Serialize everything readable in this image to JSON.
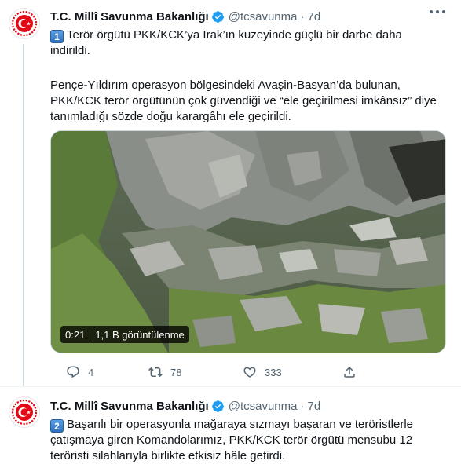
{
  "tweets": [
    {
      "account_name": "T.C. Millî Savunma Bakanlığı",
      "handle": "@tcsavunma",
      "separator": "·",
      "time": "7d",
      "number_emoji": "1",
      "lines": [
        "Terör örgütü PKK/KCK’ya Irak’ın kuzeyinde güçlü bir darbe daha",
        "indirildi.",
        "",
        "Pençe-Yıldırım operasyon bölgesindeki Avaşin-Basyan’da bulunan,",
        "PKK/KCK terör örgütünün çok güvendiği ve “ele geçirilmesi imkânsız” diye",
        "tanımladığı sözde doğu karargâhı ele geçirildi."
      ],
      "video": {
        "duration": "0:21",
        "views": "1,1 B görüntülenme"
      },
      "actions": {
        "reply_count": "4",
        "retweet_count": "78",
        "like_count": "333"
      }
    },
    {
      "account_name": "T.C. Millî Savunma Bakanlığı",
      "handle": "@tcsavunma",
      "separator": "·",
      "time": "7d",
      "number_emoji": "2",
      "lines": [
        "Başarılı bir operasyonla mağaraya sızmayı başaran ve teröristlerle",
        "çatışmaya giren Komandolarımız, PKK/KCK terör örgütü mensubu 12",
        "teröristi silahlarıyla birlikte etkisiz hâle getirdi."
      ]
    }
  ],
  "colors": {
    "text_primary": "#0f1419",
    "text_secondary": "#536471",
    "verified_blue": "#1d9bf0",
    "divider": "#eff3f4",
    "logo_red": "#e30a17"
  },
  "icons": [
    "verified-badge-icon",
    "more-icon",
    "reply-icon",
    "retweet-icon",
    "like-icon",
    "share-icon"
  ]
}
